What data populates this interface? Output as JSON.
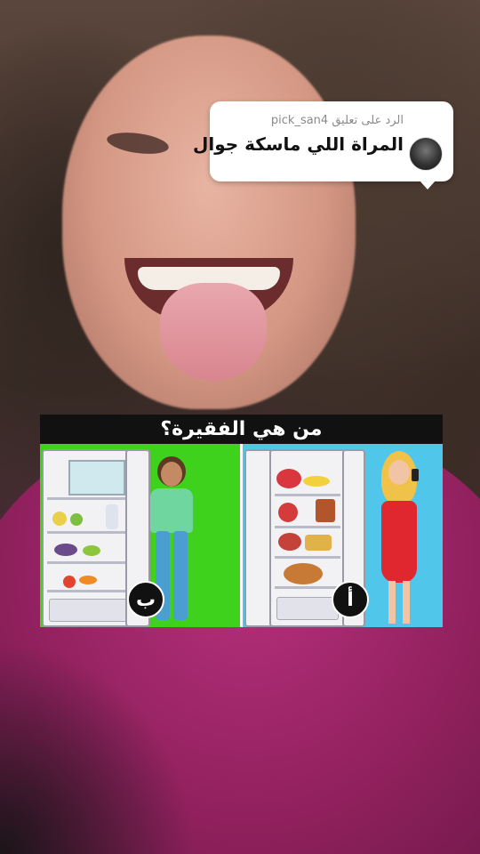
{
  "reply": {
    "header": "الرد على تعليق pick_san4",
    "text": "المراة اللي ماسكة جوال"
  },
  "quiz": {
    "title": "من هي الفقيرة؟",
    "left_label": "ب",
    "right_label": "أ"
  },
  "colors": {
    "left_panel": "#3fd21c",
    "right_panel": "#4fc6ea",
    "shirt": "#a82a72"
  }
}
